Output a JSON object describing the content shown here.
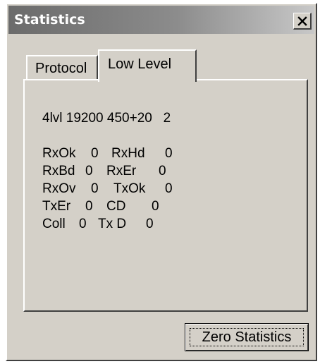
{
  "window": {
    "title": "Statistics",
    "close_symbol": "×"
  },
  "tabs": [
    {
      "label": "Protocol",
      "selected": false
    },
    {
      "label": "Low Level",
      "selected": true
    }
  ],
  "low_level": {
    "config_line": "4lvl 19200 450+20   2",
    "counters": [
      {
        "name": "RxOk",
        "value": "0"
      },
      {
        "name": "RxHd",
        "value": "0"
      },
      {
        "name": "RxBd",
        "value": "0"
      },
      {
        "name": "RxEr",
        "value": "0"
      },
      {
        "name": "RxOv",
        "value": "0"
      },
      {
        "name": "TxOk",
        "value": "0"
      },
      {
        "name": "TxEr",
        "value": "0"
      },
      {
        "name": "CD",
        "value": "0"
      },
      {
        "name": "Coll",
        "value": "0"
      },
      {
        "name": "Tx D",
        "value": "0"
      }
    ]
  },
  "buttons": {
    "zero_statistics": "Zero Statistics"
  },
  "icons": {
    "close": "close-icon"
  }
}
